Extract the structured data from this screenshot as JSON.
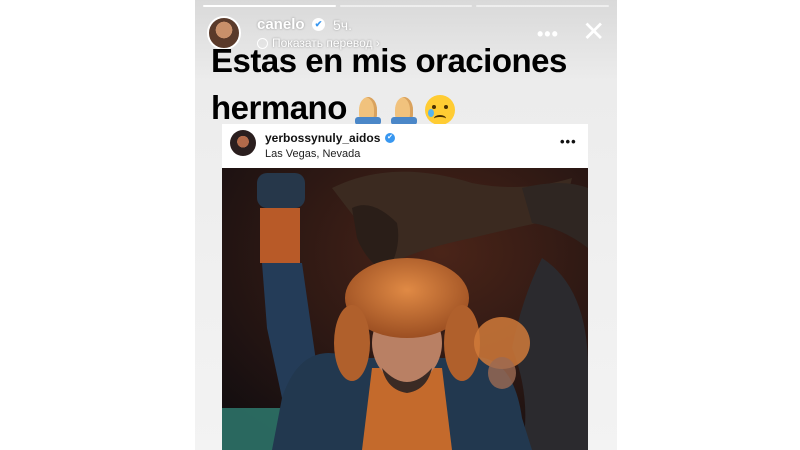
{
  "story": {
    "username": "canelo",
    "verified_glyph": "✔",
    "time": "5ч.",
    "translate_label": "Показать перевод",
    "translate_arrow": "›",
    "more_glyph": "•••",
    "close_glyph": "✕",
    "progress": {
      "segments": 3,
      "completed": 1
    },
    "caption_line1": "Estas en mis oraciones",
    "caption_line2": "hermano",
    "caption_emojis": [
      "folded-hands",
      "folded-hands",
      "crying-face"
    ]
  },
  "post": {
    "username": "yerbossynuly_aidos",
    "verified_glyph": "✔",
    "location": "Las Vegas, Nevada",
    "more_glyph": "•••"
  },
  "colors": {
    "verified_blue": "#3897f0",
    "caption_text": "#000000",
    "overlay_text": "#ffffff",
    "fur_hat": "#c46a2c",
    "jacket": "#243c58",
    "eagle": "#3b2a20"
  },
  "icons": [
    "verified-badge-icon",
    "globe-icon",
    "more-options-icon",
    "close-icon",
    "folded-hands-emoji",
    "crying-face-emoji"
  ]
}
